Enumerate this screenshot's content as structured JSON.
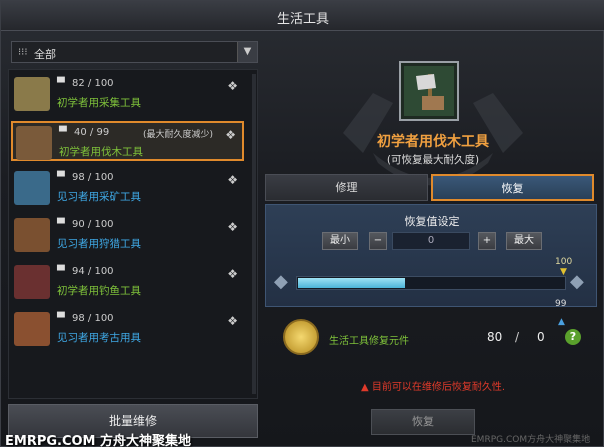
{
  "window": {
    "title": "生活工具"
  },
  "filter": {
    "selected": "全部",
    "grid_icon": "grid-icon",
    "dropdown_icon": "chevron-down-icon"
  },
  "items": [
    {
      "durability": "82 / 100",
      "name": "初学者用采集工具",
      "name_color": "#7fc23a",
      "note": "",
      "selected": false,
      "thumb_color": "#8a7a4a"
    },
    {
      "durability": "40 / 99",
      "name": "初学者用伐木工具",
      "name_color": "#7fc23a",
      "note": "(最大耐久度减少)",
      "selected": true,
      "thumb_color": "#7a5a3a"
    },
    {
      "durability": "98 / 100",
      "name": "见习者用采矿工具",
      "name_color": "#3fa9e6",
      "note": "",
      "selected": false,
      "thumb_color": "#3a6a8a"
    },
    {
      "durability": "90 / 100",
      "name": "见习者用狩猎工具",
      "name_color": "#3fa9e6",
      "note": "",
      "selected": false,
      "thumb_color": "#7a5030"
    },
    {
      "durability": "94 / 100",
      "name": "初学者用钓鱼工具",
      "name_color": "#7fc23a",
      "note": "",
      "selected": false,
      "thumb_color": "#6a3030"
    },
    {
      "durability": "98 / 100",
      "name": "见习者用考古用具",
      "name_color": "#3fa9e6",
      "note": "",
      "selected": false,
      "thumb_color": "#8a5030"
    }
  ],
  "bulk_repair": "批量维修",
  "detail": {
    "title": "初学者用伐木工具",
    "subtitle": "(可恢复最大耐久度)",
    "tabs": {
      "repair": "修理",
      "restore": "恢复"
    },
    "restore_setting": "恢复值设定",
    "min_label": "最小",
    "minus": "−",
    "value": "0",
    "plus": "+",
    "max_label": "最大",
    "max_marker": "100",
    "current_marker": "99",
    "current_fraction": 0.4
  },
  "material": {
    "name": "生活工具修复元件",
    "owned": "80",
    "separator": "/",
    "required": "0",
    "help": "?"
  },
  "warning": "目前可以在维修后恢复耐久性.",
  "restore_button": "恢复",
  "watermark": "EMRPG.COM 方舟大神聚集地",
  "watermark_small": "EMRPG.COM方舟大神聚集地"
}
